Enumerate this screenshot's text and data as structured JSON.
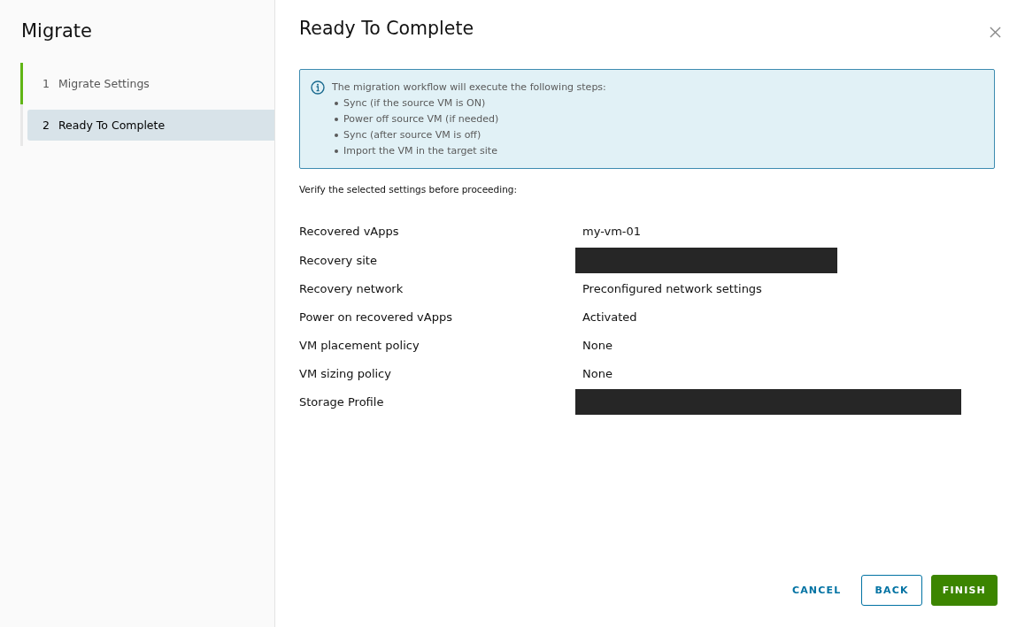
{
  "sidebar": {
    "title": "Migrate",
    "steps": [
      {
        "number": "1",
        "label": "Migrate Settings",
        "completed": true,
        "selected": false
      },
      {
        "number": "2",
        "label": "Ready To Complete",
        "completed": false,
        "selected": true
      }
    ]
  },
  "dialog": {
    "title": "Ready To Complete",
    "info_alert": {
      "message": "The migration workflow will execute the following steps:",
      "items": [
        "Sync (if the source VM is ON)",
        "Power off source VM (if needed)",
        "Sync (after source VM is off)",
        "Import the VM in the target site"
      ]
    },
    "instruction": "Verify the selected settings before proceeding:",
    "settings": [
      {
        "label": "Recovered vApps",
        "kind": "value",
        "value": "my-vm-01"
      },
      {
        "label": "Recovery site",
        "kind": "redacted"
      },
      {
        "label": "Recovery network",
        "kind": "value",
        "value": "Preconfigured network settings"
      },
      {
        "label": "Power on recovered vApps",
        "kind": "value",
        "value": "Activated"
      },
      {
        "label": "VM placement policy",
        "kind": "value",
        "value": "None"
      },
      {
        "label": "VM sizing policy",
        "kind": "value",
        "value": "None"
      },
      {
        "label": "Storage Profile",
        "kind": "redacted"
      }
    ]
  },
  "buttons": [
    {
      "label": "CANCEL",
      "kind": "flat"
    },
    {
      "label": "BACK",
      "kind": "outline"
    },
    {
      "label": "FINISH",
      "kind": "primary"
    }
  ]
}
